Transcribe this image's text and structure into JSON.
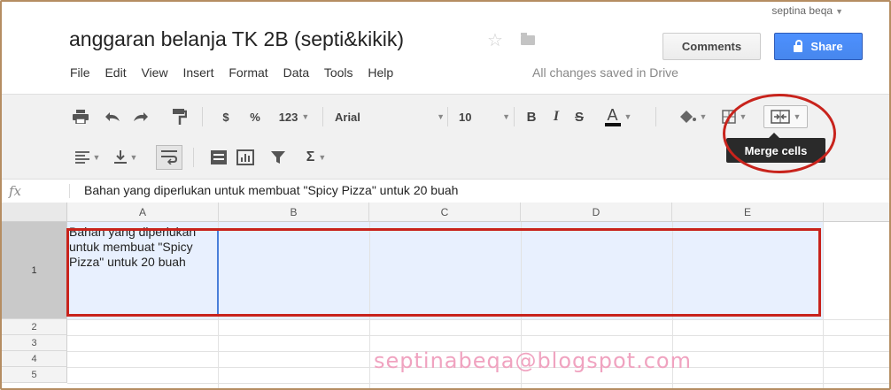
{
  "header": {
    "user": "septina beqa",
    "doc_title": "anggaran belanja TK 2B (septi&kikik)",
    "comments_label": "Comments",
    "share_label": "Share",
    "saved_status": "All changes saved in Drive"
  },
  "menu": [
    "File",
    "Edit",
    "View",
    "Insert",
    "Format",
    "Data",
    "Tools",
    "Help"
  ],
  "toolbar": {
    "currency": "$",
    "percent": "%",
    "more_formats": "123",
    "font": "Arial",
    "font_size": "10",
    "bold": "B",
    "italic": "I",
    "strike": "S",
    "text_color": "A",
    "sum": "Σ",
    "tooltip": "Merge cells"
  },
  "formula_bar": {
    "fx": "fx",
    "content": "Bahan yang diperlukan untuk membuat \"Spicy Pizza\" untuk 20 buah"
  },
  "grid": {
    "columns": [
      "A",
      "B",
      "C",
      "D",
      "E"
    ],
    "rows": [
      "1",
      "2",
      "3",
      "4",
      "5"
    ],
    "cell_a1": "Bahan yang diperlukan untuk membuat \"Spicy Pizza\" untuk 20 buah"
  },
  "watermark": "septinabeqa@blogspot.com",
  "colors": {
    "share_blue": "#4d90fe",
    "highlight_red": "#c8231c",
    "selection_blue": "#e8f0fe",
    "watermark_pink": "#f0a3c0"
  }
}
